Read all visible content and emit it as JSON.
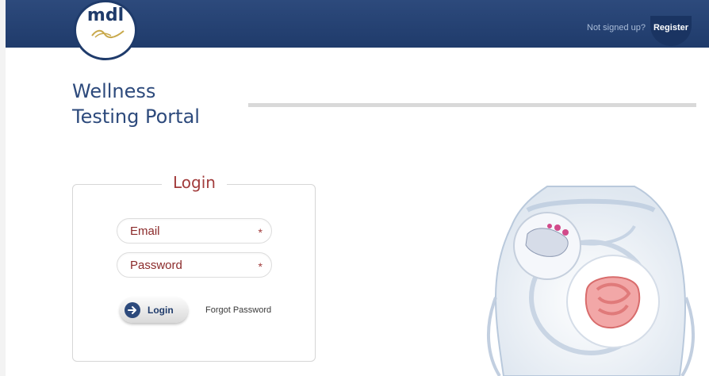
{
  "header": {
    "logo_text": "mdl",
    "not_signed_text": "Not signed up?",
    "register_label": "Register"
  },
  "page": {
    "title_line1": "Wellness",
    "title_line2": "Testing Portal"
  },
  "login": {
    "legend": "Login",
    "email_label": "Email",
    "password_label": "Password",
    "required_mark": "*",
    "button_label": "Login",
    "forgot_label": "Forgot Password"
  },
  "colors": {
    "header_bg": "#1f3b6b",
    "title": "#2d4a7c",
    "accent_red": "#a23c3c"
  },
  "icons": {
    "login_button_icon": "arrow-right-circle-icon",
    "illustration": "body-intestine-illustration"
  }
}
